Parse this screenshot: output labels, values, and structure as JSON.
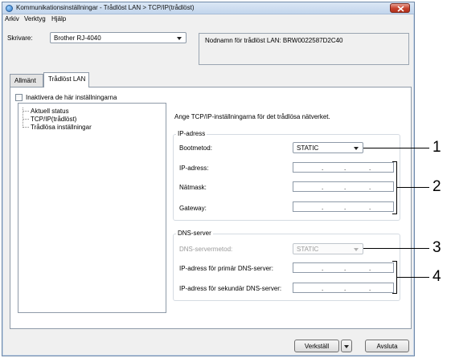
{
  "window": {
    "title": "Kommunikationsinställningar - Trådlöst LAN > TCP/IP(trådlöst)"
  },
  "menu": [
    {
      "label": "Arkiv"
    },
    {
      "label": "Verktyg"
    },
    {
      "label": "Hjälp"
    }
  ],
  "printer": {
    "label": "Skrivare:",
    "value": "Brother RJ-4040"
  },
  "node_info": "Nodnamn för trådlöst LAN: BRW0022587D2C40",
  "tabs": [
    {
      "label": "Allmänt"
    },
    {
      "label": "Trådlöst LAN"
    }
  ],
  "disable_settings": {
    "label": "Inaktivera de här inställningarna",
    "checked": false
  },
  "tree": [
    {
      "label": "Aktuell status"
    },
    {
      "label": "TCP/IP(trådlöst)"
    },
    {
      "label": "Trådlösa inställningar"
    }
  ],
  "description": "Ange TCP/IP-inställningarna för det trådlösa nätverket.",
  "ip_group": {
    "legend": "IP-adress",
    "boot_label": "Bootmetod:",
    "boot_value": "STATIC",
    "ip_label": "IP-adress:",
    "mask_label": "Nätmask:",
    "gateway_label": "Gateway:"
  },
  "dns_group": {
    "legend": "DNS-server",
    "method_label": "DNS-servermetod:",
    "method_value": "STATIC",
    "primary_label": "IP-adress för primär DNS-server:",
    "secondary_label": "IP-adress för sekundär DNS-server:"
  },
  "ip_separator": ".",
  "buttons": {
    "apply": "Verkställ",
    "exit": "Avsluta"
  },
  "callouts": [
    "1",
    "2",
    "3",
    "4"
  ]
}
